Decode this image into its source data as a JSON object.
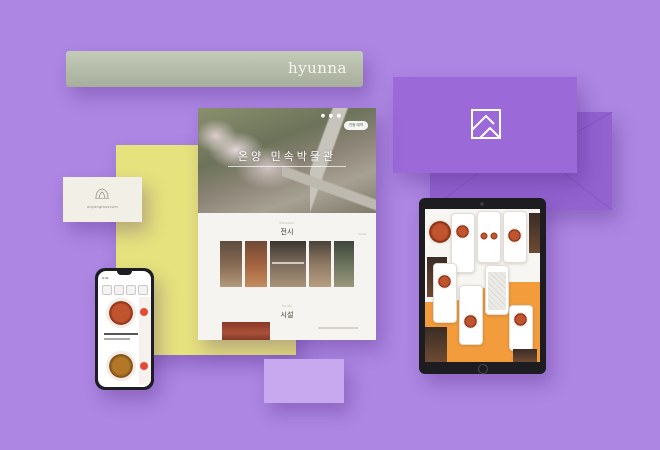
{
  "scene": {
    "brand_name": "hyunna",
    "background_color": "#ac86e2",
    "accent_yellow": "#e6e27e",
    "accent_lavender": "#c8a8ee",
    "box_purple": "#9b6ad8",
    "logo_icon": "diamond-square-logo-icon"
  },
  "business_card": {
    "text": "onyangmuseum",
    "icon": "tree-logo-icon"
  },
  "website": {
    "hero_title": "온양 민속박물관",
    "hero_button": "관람 예약",
    "hero_dots": "● ● ●",
    "section_1_label": "Exhibition",
    "section_1_title": "전시",
    "section_1_more": "more",
    "section_2_label": "Facility",
    "section_2_title": "시설"
  },
  "phone": {
    "status_text": "9:41",
    "app_color": "#e34a3a"
  },
  "tablet": {
    "screen_accent": "#f39c3b"
  }
}
